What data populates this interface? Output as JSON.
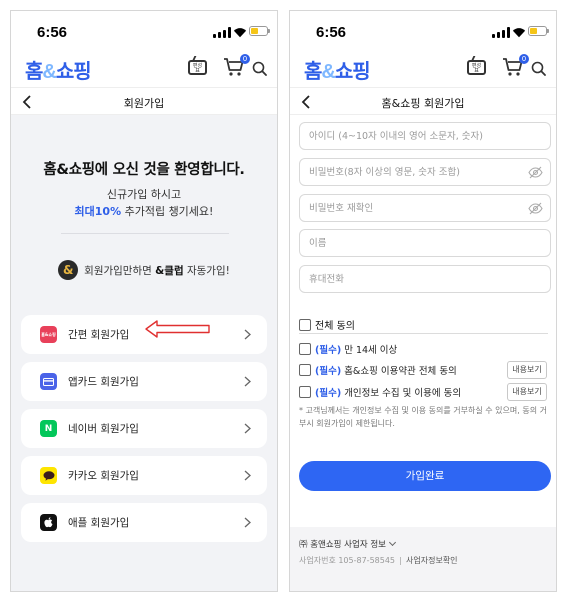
{
  "status_time": "6:56",
  "logo": {
    "prefix": "홈",
    "amp": "&",
    "suffix": "쇼핑"
  },
  "tv_icon_text": "편성표",
  "cart_count": "0",
  "left": {
    "title": "회원가입",
    "welcome": "홈&쇼핑에 오신 것을 환영합니다.",
    "sub_line1": "신규가입 하시고",
    "sub_highlight": "최대10%",
    "sub_line2_rest": " 추가적립 챙기세요!",
    "club_prefix": "회원가입만하면 ",
    "club_bold": "&클럽",
    "club_suffix": " 자동가입!",
    "club_logo": "&",
    "buttons": [
      {
        "label": "간편 회원가입",
        "icon": "홈&쇼핑",
        "icon_bg": "#e8405a",
        "icon_color": "#ffffff"
      },
      {
        "label": "앱카드 회원가입",
        "icon": "card",
        "icon_bg": "#4a63e8",
        "icon_color": "#ffffff"
      },
      {
        "label": "네이버 회원가입",
        "icon": "N",
        "icon_bg": "#03c75a",
        "icon_color": "#ffffff"
      },
      {
        "label": "카카오 회원가입",
        "icon": "talk",
        "icon_bg": "#fee500",
        "icon_color": "#3a1d1d"
      },
      {
        "label": "애플 회원가입",
        "icon": "apple",
        "icon_bg": "#111111",
        "icon_color": "#ffffff"
      }
    ]
  },
  "right": {
    "title": "홈&쇼핑 회원가입",
    "fields": {
      "id": "아이디 (4~10자 이내의 영어 소문자, 숫자)",
      "password": "비밀번호(8자 이상의 영문, 숫자 조합)",
      "password_confirm": "비밀번호 재확인",
      "name": "이름",
      "phone": "휴대전화"
    },
    "agree_all": "전체 동의",
    "required_tag": "(필수)",
    "agree_age": " 만 14세 이상",
    "agree_terms": " 홈&쇼핑 이용약관 전체 동의",
    "agree_privacy": " 개인정보 수집 및 이용에 동의",
    "more_label": "내용보기",
    "note": "* 고객님께서는 개인정보 수집 및 이용 동의를 거부하실 수 있으며, 동의 거부시 회원가입이 제한됩니다.",
    "submit": "가입완료",
    "footer_company": "㈜ 홈앤쇼핑 사업자 정보",
    "footer_biz_prefix": "사업자번호 ",
    "footer_biz_number": "105-87-58545",
    "footer_biz_link": "사업자정보확인"
  },
  "colors": {
    "brand": "#2f5fe8",
    "submit": "#2e66f3",
    "annotation_arrow": "#e03030"
  }
}
